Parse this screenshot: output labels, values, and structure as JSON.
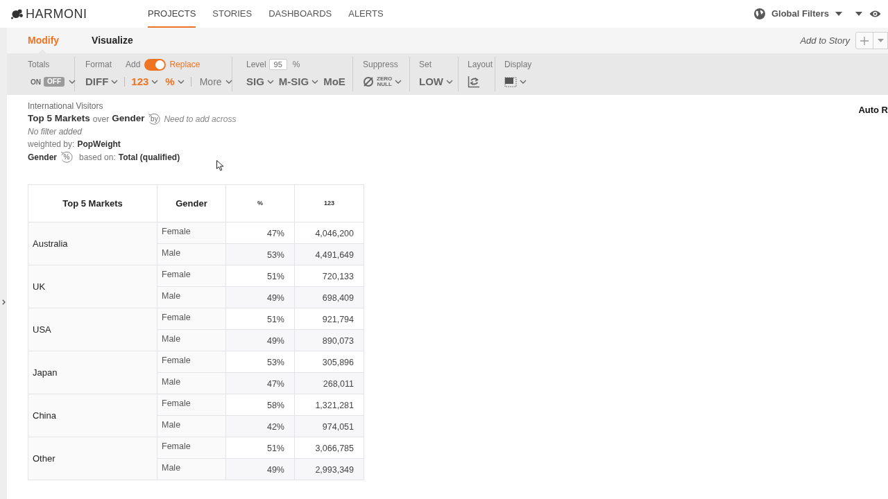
{
  "logo": "HARMONI",
  "nav": [
    {
      "label": "PROJECTS",
      "selected": true
    },
    {
      "label": "STORIES",
      "selected": false
    },
    {
      "label": "DASHBOARDS",
      "selected": false
    },
    {
      "label": "ALERTS",
      "selected": false
    }
  ],
  "global_filters": "Global Filters",
  "subtabs": [
    {
      "label": "Modify",
      "selected": true
    },
    {
      "label": "Visualize",
      "selected": false
    }
  ],
  "add_to_story": "Add to Story",
  "toolbar": {
    "totals": {
      "label": "Totals",
      "on_label": "ON",
      "off_label": "OFF",
      "on": false
    },
    "format": {
      "label": "Format",
      "add_label": "Add",
      "replace_label": "Replace",
      "replace": true,
      "controls": [
        {
          "label": "DIFF",
          "selected": false
        },
        {
          "label": "123",
          "selected": true
        },
        {
          "label": "%",
          "selected": true
        }
      ],
      "more": "More"
    },
    "level": {
      "label": "Level",
      "value": "95",
      "unit": "%",
      "controls": [
        {
          "label": "SIG",
          "kind": "dropdown"
        },
        {
          "label": "M-SIG",
          "kind": "dropdown"
        },
        {
          "label": "MoE",
          "kind": "plain"
        }
      ]
    },
    "suppress": {
      "label": "Suppress",
      "lines": [
        "ZERO",
        "NULL"
      ]
    },
    "set": {
      "label": "Set",
      "value": "LOW"
    },
    "layout": {
      "label": "Layout"
    },
    "display": {
      "label": "Display"
    }
  },
  "report": {
    "title": "International Visitors",
    "rows_variable": "Top 5 Markets",
    "over": "over",
    "columns_variable": "Gender",
    "by_icon": "by",
    "hint": "Need to add across",
    "filter": "No filter added",
    "weighted_label": "weighted by:",
    "weight": "PopWeight",
    "percent_variable": "Gender",
    "percent_icon": "%",
    "based_on_label": "based on:",
    "base": "Total (qualified)"
  },
  "side_label": "Auto R",
  "table": {
    "columns": [
      "Top 5 Markets",
      "Gender",
      "%",
      "123"
    ],
    "groups": [
      {
        "market": "Australia",
        "rows": [
          {
            "gender": "Female",
            "percent": "47%",
            "count": "4,046,200"
          },
          {
            "gender": "Male",
            "percent": "53%",
            "count": "4,491,649"
          }
        ]
      },
      {
        "market": "UK",
        "rows": [
          {
            "gender": "Female",
            "percent": "51%",
            "count": "720,133"
          },
          {
            "gender": "Male",
            "percent": "49%",
            "count": "698,409"
          }
        ]
      },
      {
        "market": "USA",
        "rows": [
          {
            "gender": "Female",
            "percent": "51%",
            "count": "921,794"
          },
          {
            "gender": "Male",
            "percent": "49%",
            "count": "890,073"
          }
        ]
      },
      {
        "market": "Japan",
        "rows": [
          {
            "gender": "Female",
            "percent": "53%",
            "count": "305,896"
          },
          {
            "gender": "Male",
            "percent": "47%",
            "count": "268,011"
          }
        ]
      },
      {
        "market": "China",
        "rows": [
          {
            "gender": "Female",
            "percent": "58%",
            "count": "1,321,281"
          },
          {
            "gender": "Male",
            "percent": "42%",
            "count": "974,051"
          }
        ]
      },
      {
        "market": "Other",
        "rows": [
          {
            "gender": "Female",
            "percent": "51%",
            "count": "3,066,785"
          },
          {
            "gender": "Male",
            "percent": "49%",
            "count": "2,993,349"
          }
        ]
      }
    ]
  }
}
